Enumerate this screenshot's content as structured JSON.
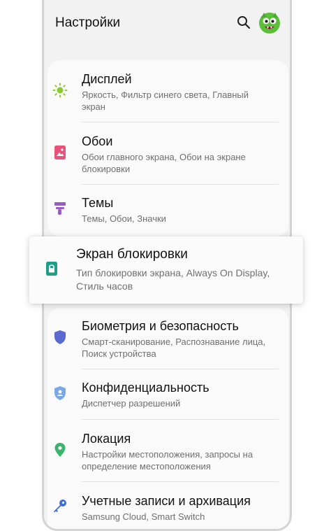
{
  "header": {
    "title": "Настройки",
    "search_icon": "search-icon",
    "avatar_icon": "avatar-icon"
  },
  "colors": {
    "display": "#8ccb2e",
    "wallpaper": "#e8537b",
    "themes": "#9b59c9",
    "lock": "#1f9e8a",
    "biometrics": "#5b6ad0",
    "privacy": "#7aa7e6",
    "location": "#3ab56b",
    "accounts": "#3f6fd1"
  },
  "items": [
    {
      "label": "Дисплей",
      "sub": "Яркость, Фильтр синего света, Главный экран",
      "icon": "sun-icon"
    },
    {
      "label": "Обои",
      "sub": "Обои главного экрана, Обои на экране блокировки",
      "icon": "wallpaper-icon"
    },
    {
      "label": "Темы",
      "sub": "Темы, Обои, Значки",
      "icon": "brush-icon"
    },
    {
      "label": "Экран блокировки",
      "sub": "Тип блокировки экрана, Always On Display, Стиль часов",
      "icon": "lock-icon"
    },
    {
      "label": "Биометрия и безопасность",
      "sub": "Смарт-сканирование, Распознавание лица, Поиск устройства",
      "icon": "shield-icon"
    },
    {
      "label": "Конфиденциальность",
      "sub": "Диспетчер разрешений",
      "icon": "privacy-shield-icon"
    },
    {
      "label": "Локация",
      "sub": "Настройки местоположения, запросы на определение местоположения",
      "icon": "location-pin-icon"
    },
    {
      "label": "Учетные записи и архивация",
      "sub": "Samsung Cloud, Smart Switch",
      "icon": "key-icon"
    }
  ]
}
